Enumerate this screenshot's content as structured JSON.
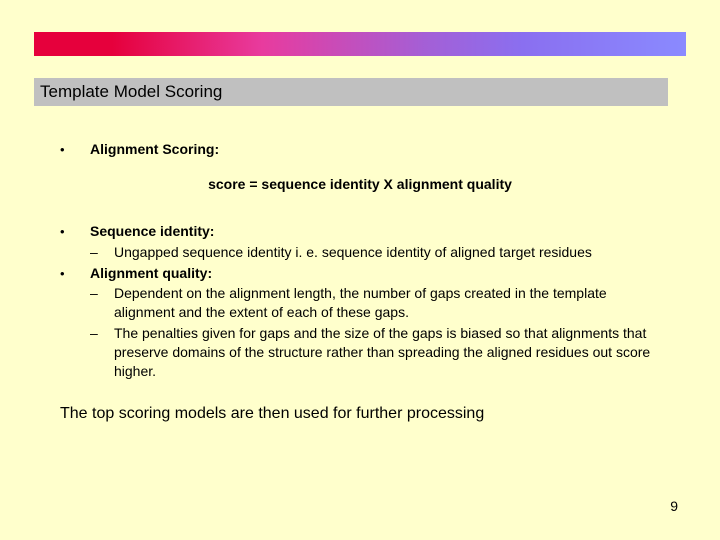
{
  "title": "Template Model Scoring",
  "bullets": {
    "b1_label": "Alignment Scoring:",
    "formula": "score = sequence identity X alignment quality",
    "b2_label": "Sequence identity:",
    "b2_sub1": "Ungapped sequence identity i. e. sequence identity of aligned target residues",
    "b3_label": "Alignment quality:",
    "b3_sub1": "Dependent on the alignment length, the number of gaps created in the template alignment and the extent of each of these gaps.",
    "b3_sub2": "The penalties given for gaps and the size of the gaps is biased so that alignments that preserve domains of the structure rather than spreading the aligned residues out score higher."
  },
  "closing": "The top scoring models are then used for further processing",
  "page_number": "9"
}
